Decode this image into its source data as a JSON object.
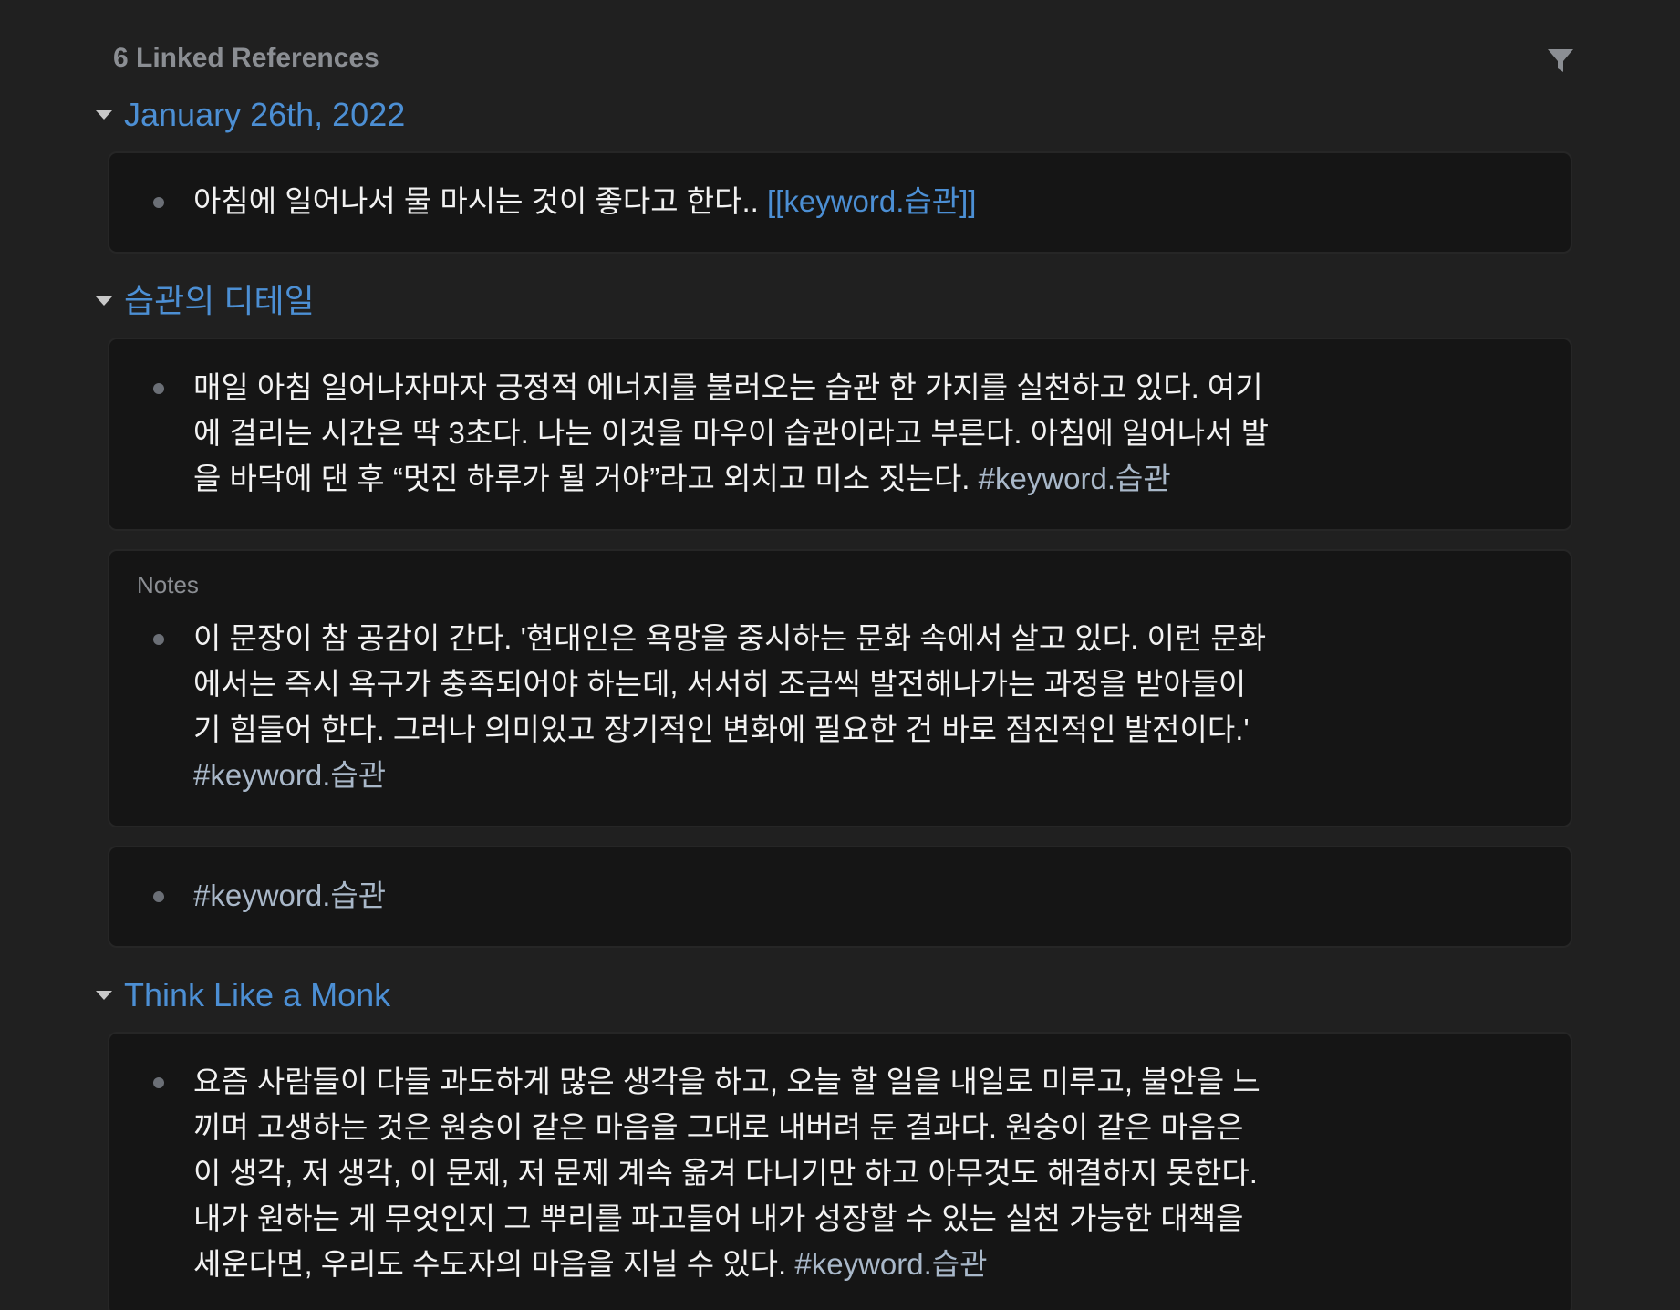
{
  "header": {
    "title": "6 Linked References"
  },
  "groups": [
    {
      "title": "January 26th, 2022",
      "cards": [
        {
          "label": "",
          "text": "아침에 일어나서 물 마시는 것이 좋다고 한다.. ",
          "link_open": "[[",
          "link": "keyword.습관",
          "link_close": "]]"
        }
      ]
    },
    {
      "title": "습관의 디테일",
      "cards": [
        {
          "label": "",
          "text": "매일 아침 일어나자마자 긍정적 에너지를 불러오는 습관 한 가지를 실천하고 있다. 여기에 걸리는 시간은 딱 3초다. 나는 이것을 마우이 습관이라고 부른다. 아침에 일어나서 발을 바닥에 댄 후 “멋진 하루가 될 거야”라고 외치고 미소 짓는다. ",
          "tag": "#keyword.습관"
        },
        {
          "label": "Notes",
          "text": "이 문장이 참 공감이 간다. '현대인은 욕망을 중시하는 문화 속에서 살고 있다. 이런 문화에서는 즉시 욕구가 충족되어야 하는데, 서서히 조금씩 발전해나가는 과정을 받아들이기 힘들어 한다. 그러나 의미있고 장기적인 변화에 필요한 건 바로 점진적인 발전이다.' ",
          "tag": "#keyword.습관"
        },
        {
          "label": "",
          "text": "",
          "tag": "#keyword.습관"
        }
      ]
    },
    {
      "title": "Think Like a Monk",
      "cards": [
        {
          "label": "",
          "text": "요즘 사람들이 다들 과도하게 많은 생각을 하고, 오늘 할 일을 내일로 미루고, 불안을 느끼며 고생하는 것은 원숭이 같은 마음을 그대로 내버려 둔 결과다. 원숭이 같은 마음은 이 생각, 저 생각, 이 문제, 저 문제 계속 옮겨 다니기만 하고 아무것도 해결하지 못한다. 내가 원하는 게 무엇인지 그 뿌리를 파고들어 내가 성장할 수 있는 실천 가능한 대책을 세운다면, 우리도 수도자의 마음을 지닐 수 있다.  ",
          "tag": "#keyword.습관"
        }
      ]
    }
  ],
  "icons": {
    "filter": "filter-icon",
    "caret": "caret-down-icon",
    "bullet": "bullet-icon"
  },
  "colors": {
    "background": "#202020",
    "card": "#151515",
    "accent": "#4c8fd4",
    "tag": "#a9b8c9",
    "muted": "#8b8e93"
  }
}
